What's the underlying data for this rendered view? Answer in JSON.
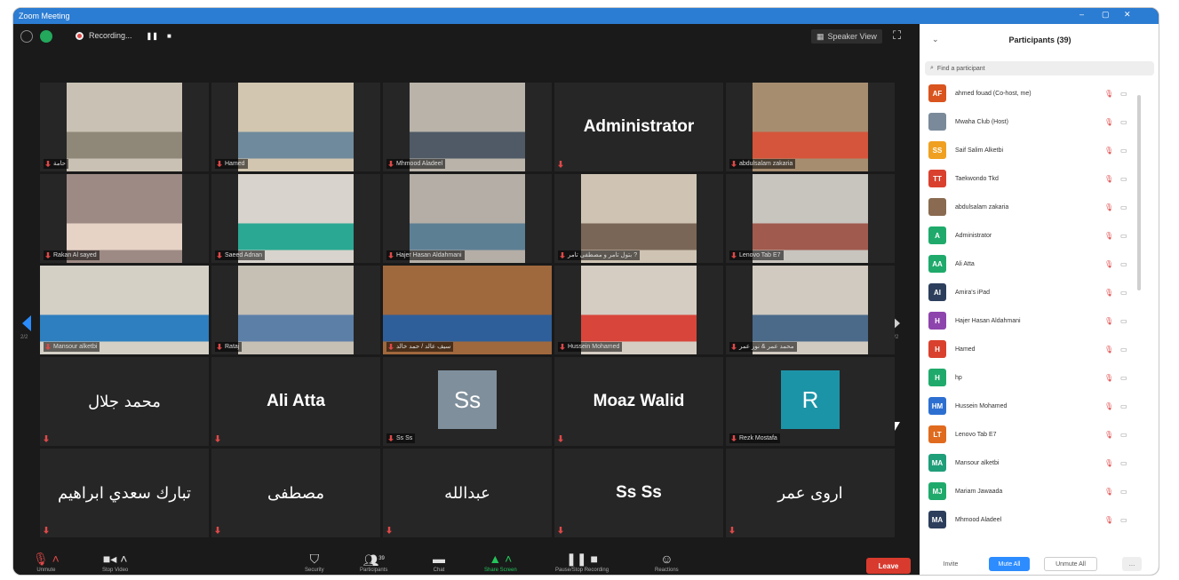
{
  "window": {
    "title": "Zoom Meeting"
  },
  "topbar": {
    "recording_label": "Recording...",
    "speaker_view": "Speaker View"
  },
  "colors": {
    "accent": "#2d8cff",
    "muted_mic": "#e04848",
    "leave": "#d93a2e"
  },
  "video_tiles": [
    {
      "name": "حامة",
      "type": "video"
    },
    {
      "name": "Hamed",
      "type": "video"
    },
    {
      "name": "Mhmood Aladeel",
      "type": "video"
    },
    {
      "name": "Administrator",
      "type": "name"
    },
    {
      "name": "abdulsalam zakaria",
      "type": "video"
    },
    {
      "name": "Rakan Al sayed",
      "type": "video"
    },
    {
      "name": "Saeed Adnan",
      "type": "video"
    },
    {
      "name": "Hajer Hasan Aldahmani",
      "type": "video"
    },
    {
      "name": "بتول تامر و مصطفى تامر ?",
      "type": "video"
    },
    {
      "name": "Lenovo Tab E7",
      "type": "video"
    },
    {
      "name": "Mansour alketbi",
      "type": "video"
    },
    {
      "name": "Rataj",
      "type": "video"
    },
    {
      "name": "سيف عالد / حمد خالد",
      "type": "video"
    },
    {
      "name": "Hussein Mohamed",
      "type": "video"
    },
    {
      "name": "محمد عمر & نور عمر",
      "type": "video"
    },
    {
      "name": "محمد جلال",
      "type": "name"
    },
    {
      "name": "Ali Atta",
      "type": "name"
    },
    {
      "name": "Ss",
      "label": "Ss Ss",
      "type": "avatar"
    },
    {
      "name": "Moaz Walid",
      "type": "name"
    },
    {
      "name": "R",
      "label": "Rezk Mostafa",
      "type": "avatar"
    },
    {
      "name": "تبارك سعدي ابراهيم",
      "type": "name"
    },
    {
      "name": "مصطفى",
      "type": "name"
    },
    {
      "name": "عبدالله",
      "type": "name"
    },
    {
      "name": "Ss Ss",
      "type": "name"
    },
    {
      "name": "اروى عمر",
      "type": "name"
    }
  ],
  "pager": {
    "left": "2/2",
    "right": "2/2"
  },
  "toolbar": {
    "unmute": "Unmute",
    "stop_video": "Stop Video",
    "security": "Security",
    "participants": "Participants",
    "participants_count": "39",
    "chat": "Chat",
    "share_screen": "Share Screen",
    "pause_recording": "Pause/Stop Recording",
    "reactions": "Reactions",
    "leave": "Leave"
  },
  "participants_panel": {
    "title": "Participants (39)",
    "search_placeholder": "Find a participant",
    "items": [
      {
        "initials": "AF",
        "name": "ahmed fouad (Co-host, me)",
        "color": "#d9541e"
      },
      {
        "initials": "",
        "name": "Mwaha Club (Host)",
        "color": "#7a8a9a"
      },
      {
        "initials": "SS",
        "name": "Saif Salim Alketbi",
        "color": "#f0a020"
      },
      {
        "initials": "TT",
        "name": "Taekwondo Tkd",
        "color": "#d9412e"
      },
      {
        "initials": "",
        "name": "abdulsalam zakaria",
        "color": "#8a6a50"
      },
      {
        "initials": "A",
        "name": "Administrator",
        "color": "#1faa6b"
      },
      {
        "initials": "AA",
        "name": "Ali Atta",
        "color": "#1faa6b"
      },
      {
        "initials": "AI",
        "name": "Amira's iPad",
        "color": "#2c3e5c"
      },
      {
        "initials": "H",
        "name": "Hajer Hasan Aldahmani",
        "color": "#8e44ad"
      },
      {
        "initials": "H",
        "name": "Hamed",
        "color": "#d9412e"
      },
      {
        "initials": "H",
        "name": "hp",
        "color": "#1faa6b"
      },
      {
        "initials": "HM",
        "name": "Hussein Mohamed",
        "color": "#2d6fd1"
      },
      {
        "initials": "LT",
        "name": "Lenovo Tab E7",
        "color": "#e06a1e"
      },
      {
        "initials": "MA",
        "name": "Mansour alketbi",
        "color": "#1f9e7a"
      },
      {
        "initials": "MJ",
        "name": "Mariam Jawaada",
        "color": "#1faa6b"
      },
      {
        "initials": "MA",
        "name": "Mhmood Aladeel",
        "color": "#2c3e5c"
      }
    ],
    "invite": "Invite",
    "mute_all": "Mute All",
    "unmute_all": "Unmute All"
  }
}
